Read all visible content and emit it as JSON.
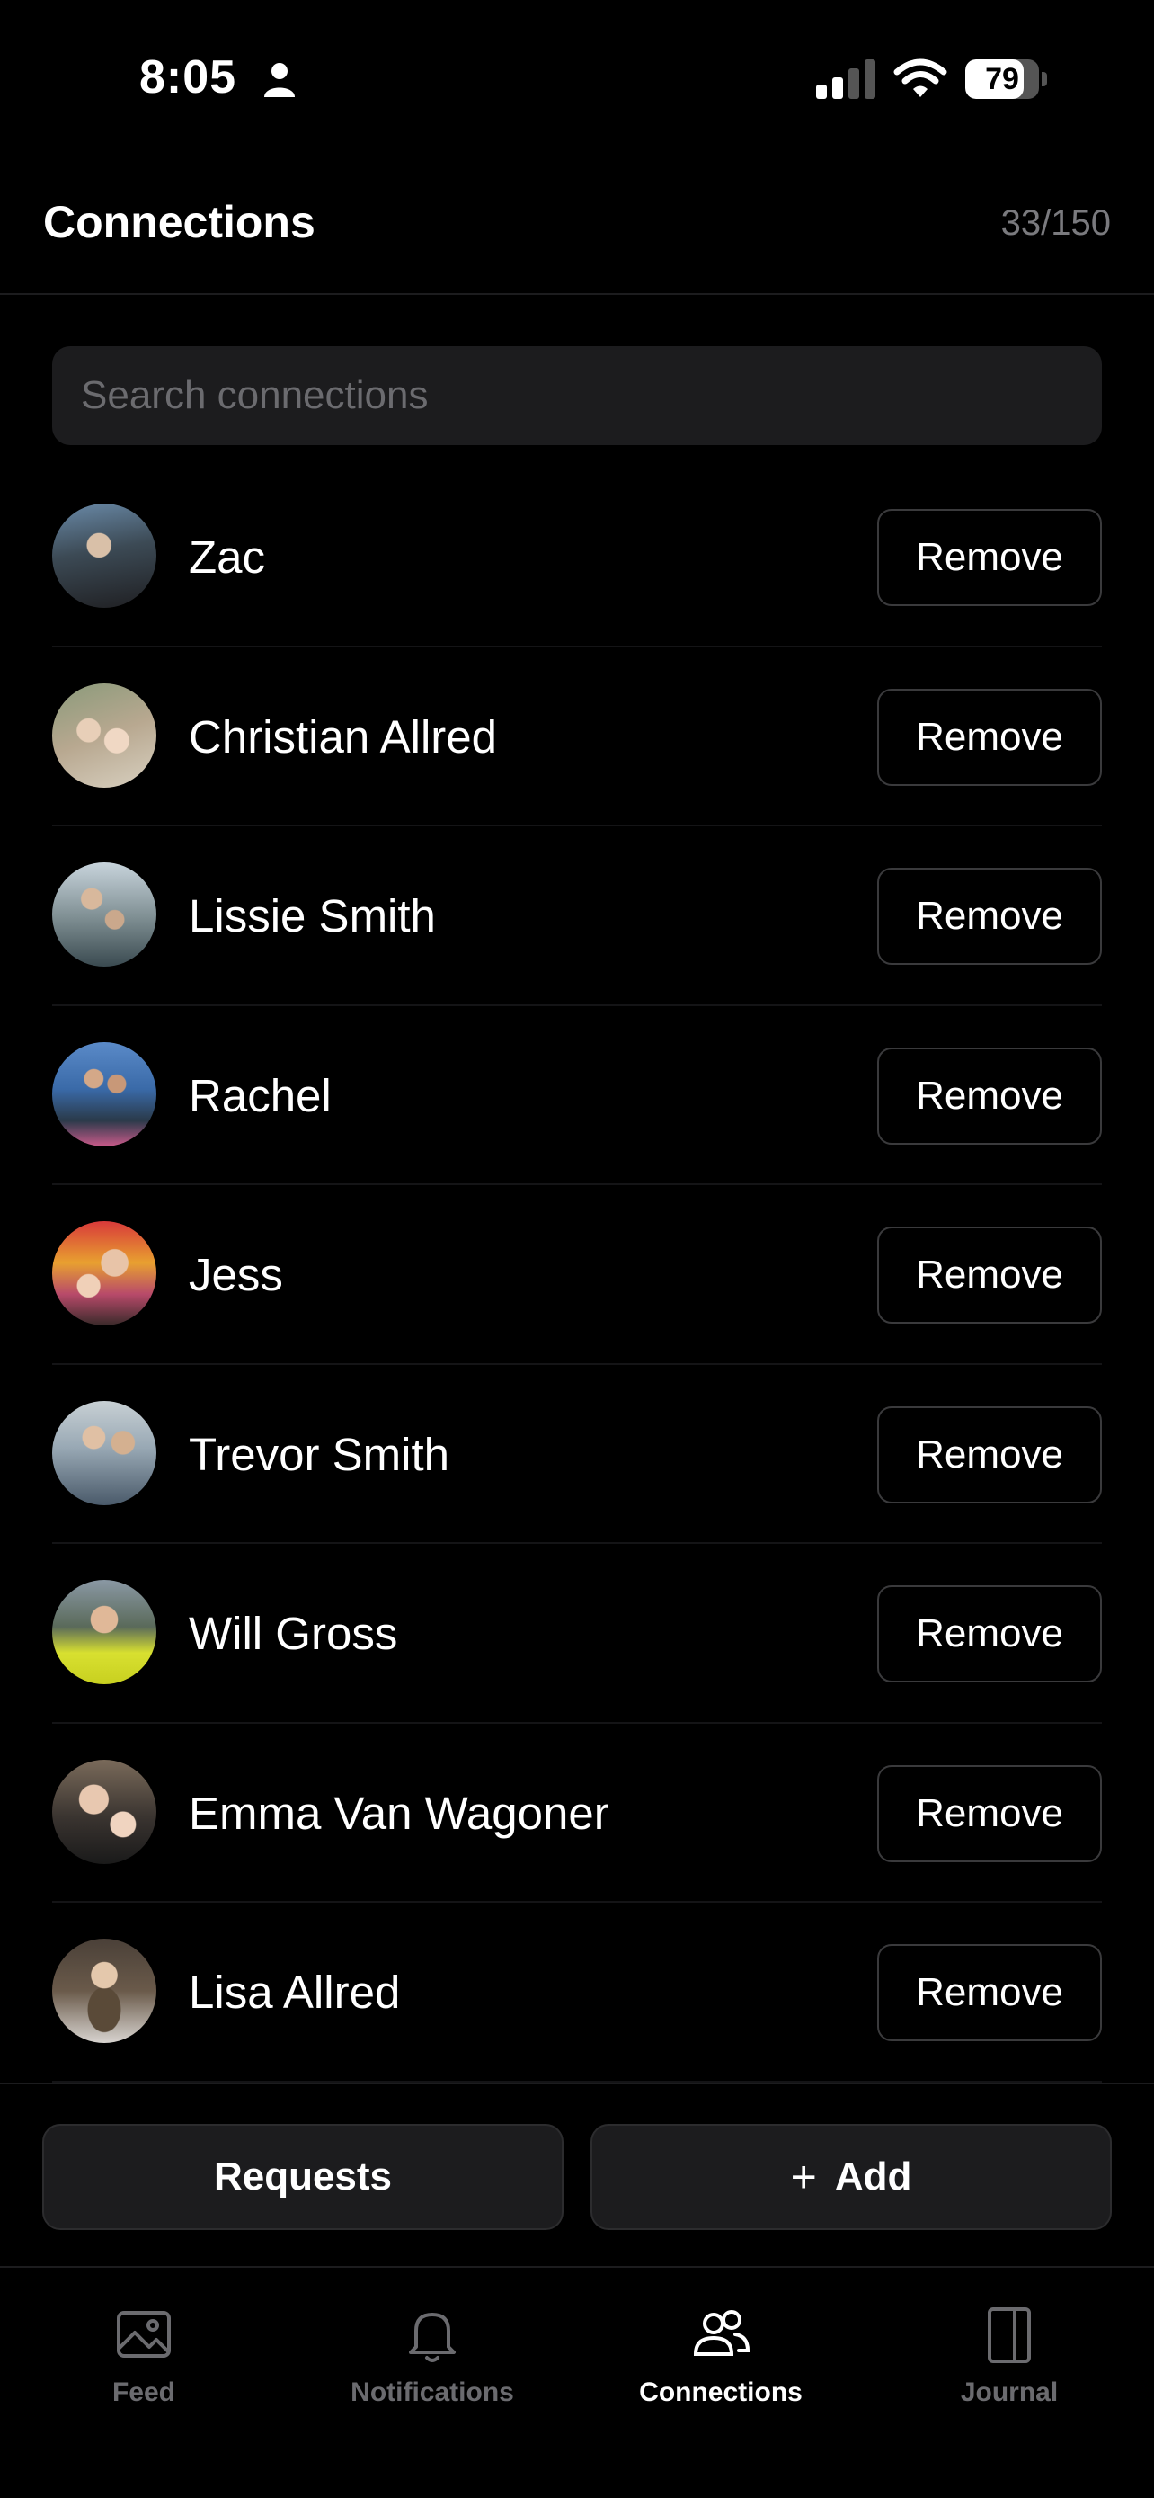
{
  "status_bar": {
    "time": "8:05",
    "battery": "79",
    "battery_level": 0.79,
    "icons": [
      "person-icon",
      "signal-icon",
      "wifi-icon",
      "battery-icon"
    ]
  },
  "header": {
    "title": "Connections",
    "count": "33/150"
  },
  "search": {
    "placeholder": "Search connections",
    "value": ""
  },
  "connections": [
    {
      "name": "Zac",
      "action": "Remove"
    },
    {
      "name": "Christian Allred",
      "action": "Remove"
    },
    {
      "name": "Lissie Smith",
      "action": "Remove"
    },
    {
      "name": "Rachel",
      "action": "Remove"
    },
    {
      "name": "Jess",
      "action": "Remove"
    },
    {
      "name": "Trevor Smith",
      "action": "Remove"
    },
    {
      "name": "Will Gross",
      "action": "Remove"
    },
    {
      "name": "Emma Van Wagoner",
      "action": "Remove"
    },
    {
      "name": "Lisa Allred",
      "action": "Remove"
    }
  ],
  "actions": {
    "requests_label": "Requests",
    "add_label": "Add",
    "add_icon": "plus-icon"
  },
  "tabbar": {
    "tabs": [
      {
        "label": "Feed",
        "icon": "image-icon",
        "active": false
      },
      {
        "label": "Notifications",
        "icon": "bell-icon",
        "active": false
      },
      {
        "label": "Connections",
        "icon": "people-icon",
        "active": true
      },
      {
        "label": "Journal",
        "icon": "journal-icon",
        "active": false
      }
    ]
  },
  "colors": {
    "background": "#000000",
    "surface": "#1c1c1e",
    "muted_text": "#6b6b6f",
    "border": "#3a3a3c"
  }
}
